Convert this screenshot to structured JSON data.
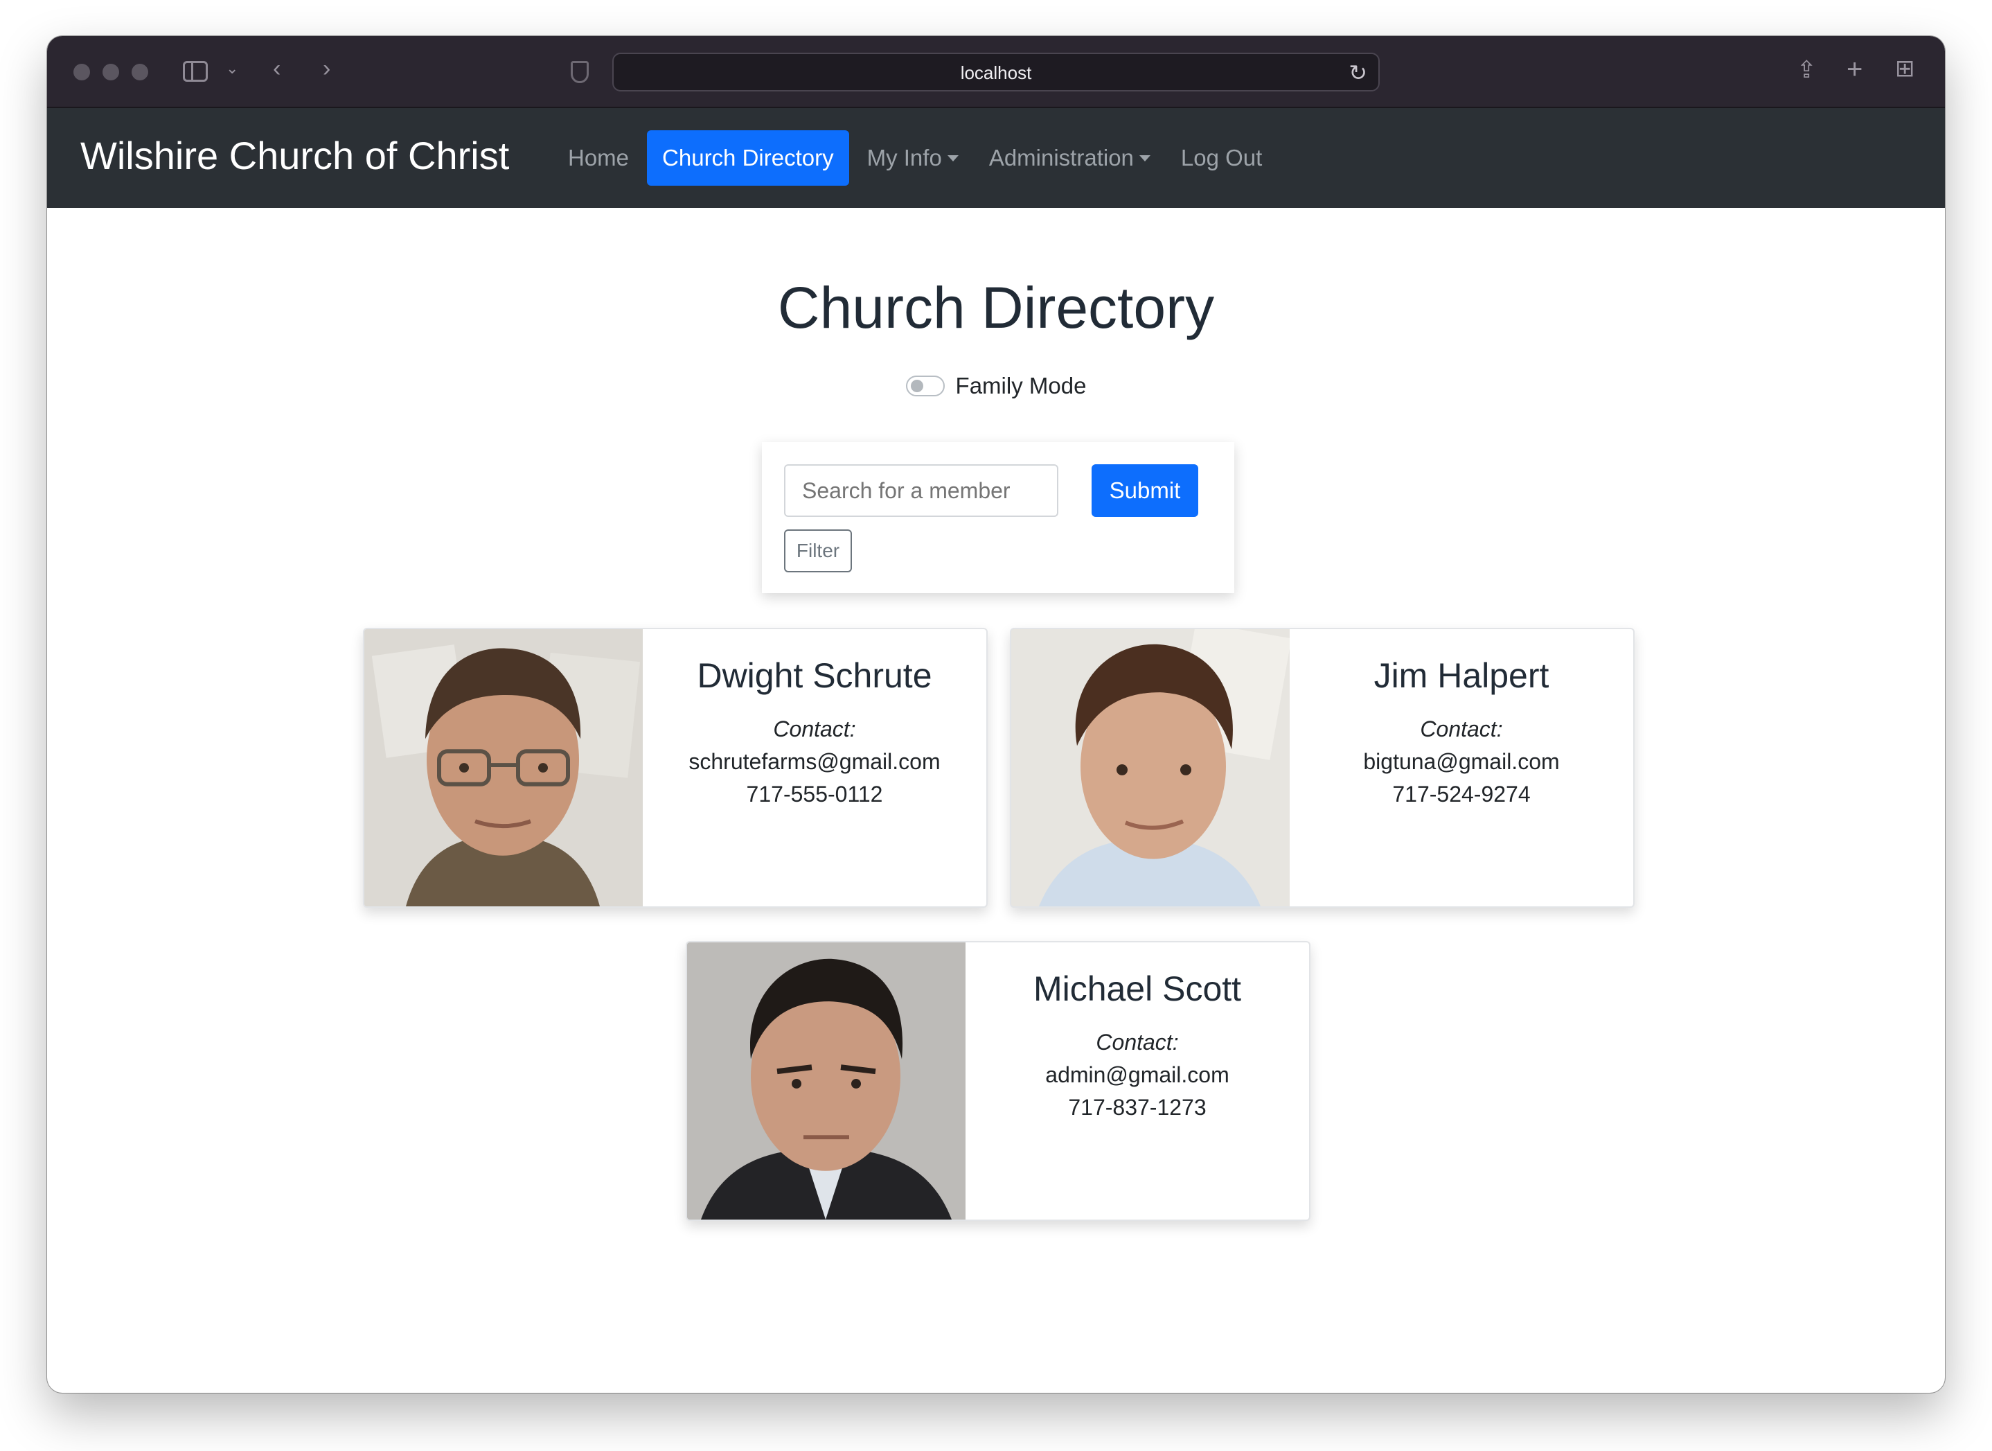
{
  "browser": {
    "url": "localhost"
  },
  "navbar": {
    "brand": "Wilshire Church of Christ",
    "links": [
      {
        "label": "Home"
      },
      {
        "label": "Church Directory",
        "active": true
      },
      {
        "label": "My Info",
        "dropdown": true
      },
      {
        "label": "Administration",
        "dropdown": true
      },
      {
        "label": "Log Out"
      }
    ]
  },
  "page": {
    "title": "Church Directory",
    "family_mode_label": "Family Mode",
    "family_mode_on": false
  },
  "search": {
    "placeholder": "Search for a member",
    "submit_label": "Submit",
    "filter_label": "Filter"
  },
  "members": [
    {
      "name": "Dwight Schrute",
      "contact_label": "Contact:",
      "email": "schrutefarms@gmail.com",
      "phone": "717-555-0112"
    },
    {
      "name": "Jim Halpert",
      "contact_label": "Contact:",
      "email": "bigtuna@gmail.com",
      "phone": "717-524-9274"
    },
    {
      "name": "Michael Scott",
      "contact_label": "Contact:",
      "email": "admin@gmail.com",
      "phone": "717-837-1273"
    }
  ],
  "colors": {
    "accent": "#0d6efd",
    "navbar_bg": "#2b3035",
    "chrome_bg": "#2b2630"
  }
}
